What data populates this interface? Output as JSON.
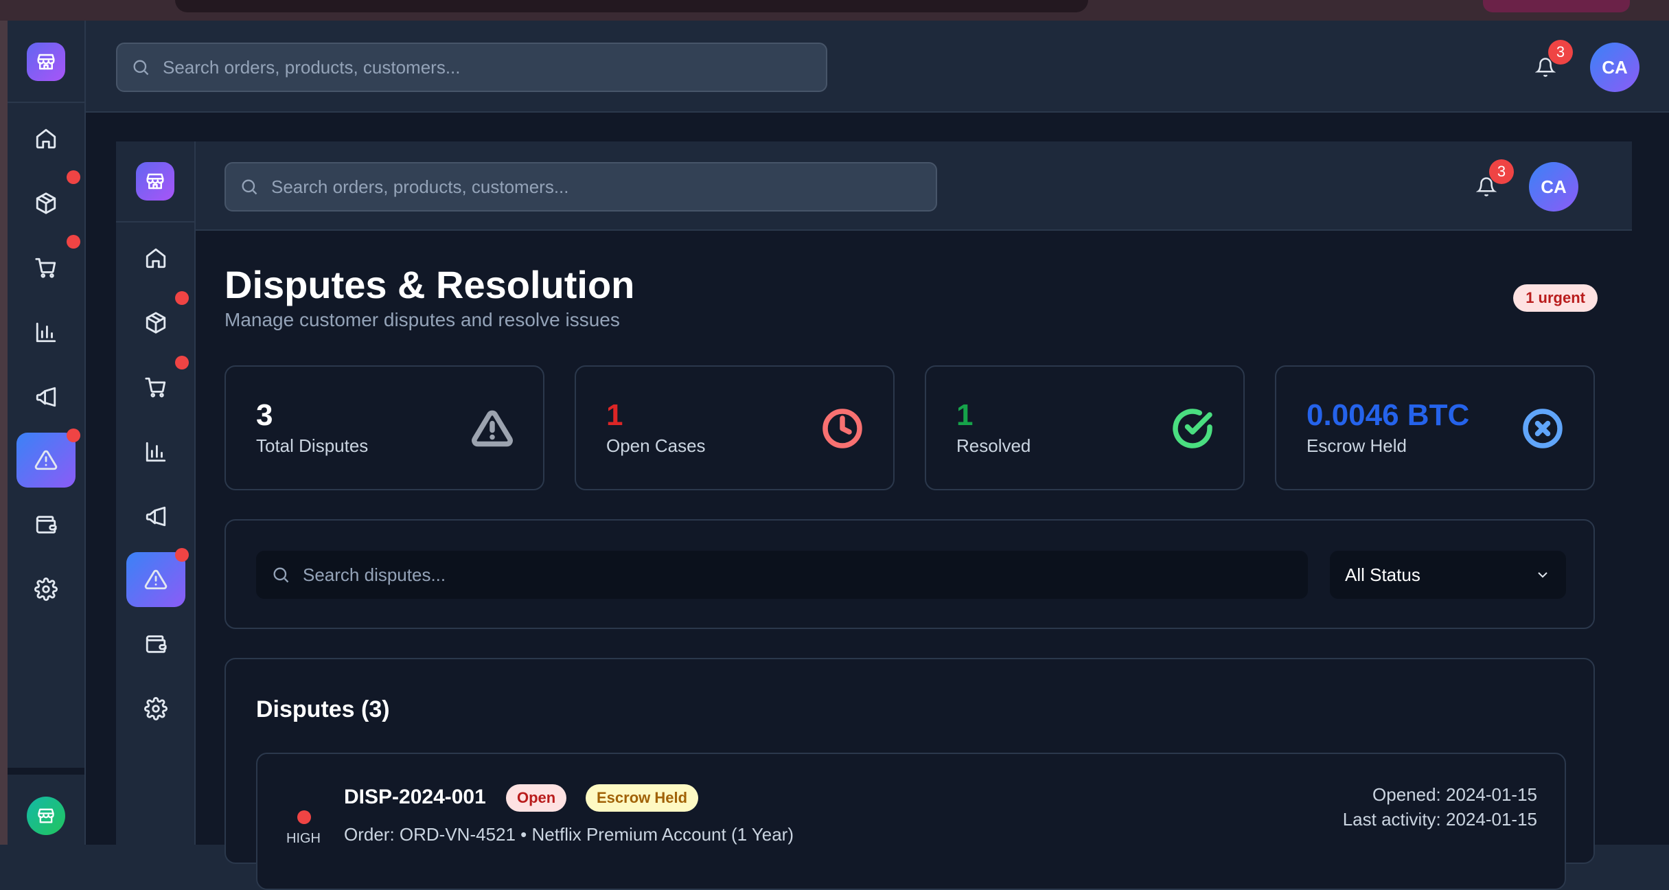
{
  "header": {
    "search_placeholder": "Search orders, products, customers...",
    "notification_count": "3",
    "avatar_initials": "CA"
  },
  "sidebar": {
    "items": [
      {
        "icon": "home-icon",
        "badge": false,
        "active": false
      },
      {
        "icon": "package-icon",
        "badge": true,
        "active": false
      },
      {
        "icon": "cart-icon",
        "badge": true,
        "active": false
      },
      {
        "icon": "bar-chart-icon",
        "badge": false,
        "active": false
      },
      {
        "icon": "megaphone-icon",
        "badge": false,
        "active": false
      },
      {
        "icon": "alert-triangle-icon",
        "badge": true,
        "active": true
      },
      {
        "icon": "wallet-icon",
        "badge": false,
        "active": false
      },
      {
        "icon": "settings-icon",
        "badge": false,
        "active": false
      }
    ]
  },
  "page": {
    "title": "Disputes & Resolution",
    "subtitle": "Manage customer disputes and resolve issues",
    "urgent_badge": "1 urgent"
  },
  "stats": [
    {
      "value": "3",
      "label": "Total Disputes",
      "color": "#ffffff",
      "icon": "alert-triangle-icon"
    },
    {
      "value": "1",
      "label": "Open Cases",
      "color": "#dc2626",
      "icon": "clock-icon"
    },
    {
      "value": "1",
      "label": "Resolved",
      "color": "#16a34a",
      "icon": "check-circle-icon"
    },
    {
      "value": "0.0046 BTC",
      "label": "Escrow Held",
      "color": "#2563eb",
      "icon": "x-circle-icon"
    }
  ],
  "filters": {
    "search_placeholder": "Search disputes...",
    "status_selected": "All Status"
  },
  "disputes": {
    "title": "Disputes (3)",
    "rows": [
      {
        "priority": "HIGH",
        "id": "DISP-2024-001",
        "status": "Open",
        "escrow": "Escrow Held",
        "order": "Order: ORD-VN-4521 • Netflix Premium Account (1 Year)",
        "opened": "Opened: 2024-01-15",
        "last_activity": "Last activity: 2024-01-15"
      }
    ]
  },
  "colors": {
    "accent_gradient_start": "#3b82f6",
    "accent_gradient_end": "#8b5cf6",
    "danger": "#ef4444",
    "background": "#111827",
    "panel": "#1e293b"
  }
}
